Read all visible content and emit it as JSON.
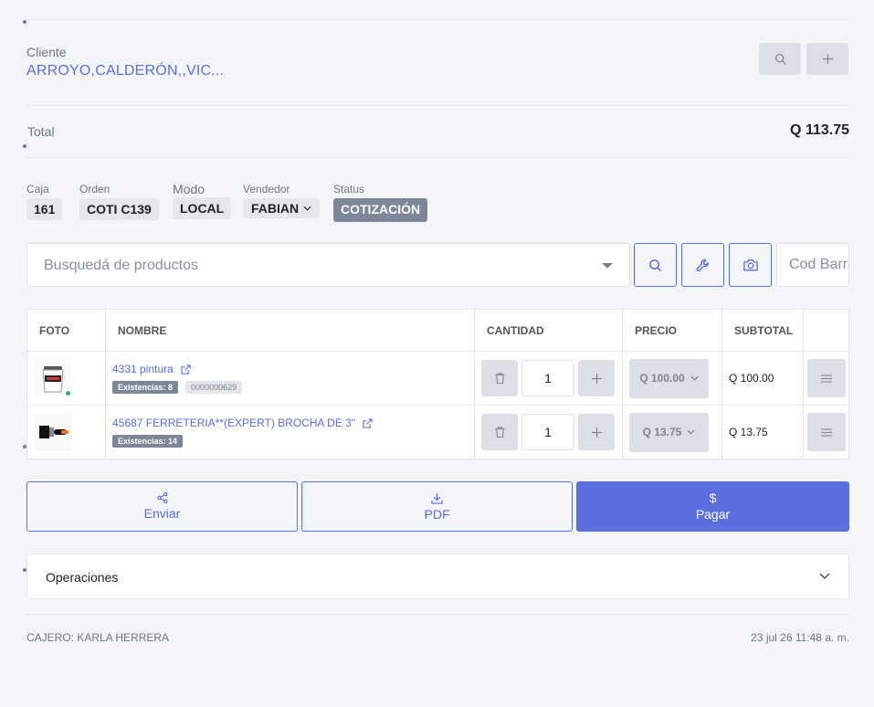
{
  "client": {
    "label": "Cliente",
    "name": "ARROYO,CALDERÓN,,VIC..."
  },
  "total": {
    "label": "Total",
    "value": "Q 113.75"
  },
  "info": {
    "caja_label": "Caja",
    "caja_value": "161",
    "orden_label": "Orden",
    "orden_value": "COTI C139",
    "modo_label": "Modo",
    "modo_value": "LOCAL",
    "vendedor_label": "Vendedor",
    "vendedor_value": "FABIAN",
    "status_label": "Status",
    "status_value": "COTIZACIÓN"
  },
  "search": {
    "placeholder": "Busquedá de productos",
    "barcode_placeholder": "Cod Barras"
  },
  "table": {
    "headers": [
      "FOTO",
      "NOMBRE",
      "CANTIDAD",
      "PRECIO",
      "SUBTOTAL",
      ""
    ],
    "rows": [
      {
        "name": "4331 pintura",
        "stock": "Existencias: 8",
        "code": "0000000629",
        "qty": "1",
        "price": "Q 100.00",
        "subtotal": "Q 100.00"
      },
      {
        "name": "45687 FERRETERIA**(EXPERT) BROCHA DE 3\"",
        "stock": "Existencias: 14",
        "qty": "1",
        "price": "Q 13.75",
        "subtotal": "Q 13.75"
      }
    ]
  },
  "actions": {
    "send": "Enviar",
    "pdf": "PDF",
    "pay_symbol": "$",
    "pay": "Pagar"
  },
  "operations": {
    "label": "Operaciones"
  },
  "footer": {
    "cashier": "CAJERO: KARLA HERRERA",
    "datetime": "23 jul 26 11:48 a. m."
  },
  "colors": {
    "accent": "#5a6ee0",
    "muted_button": "#dddfe6",
    "status_badge": "#7e8699",
    "online": "#2bb673"
  }
}
